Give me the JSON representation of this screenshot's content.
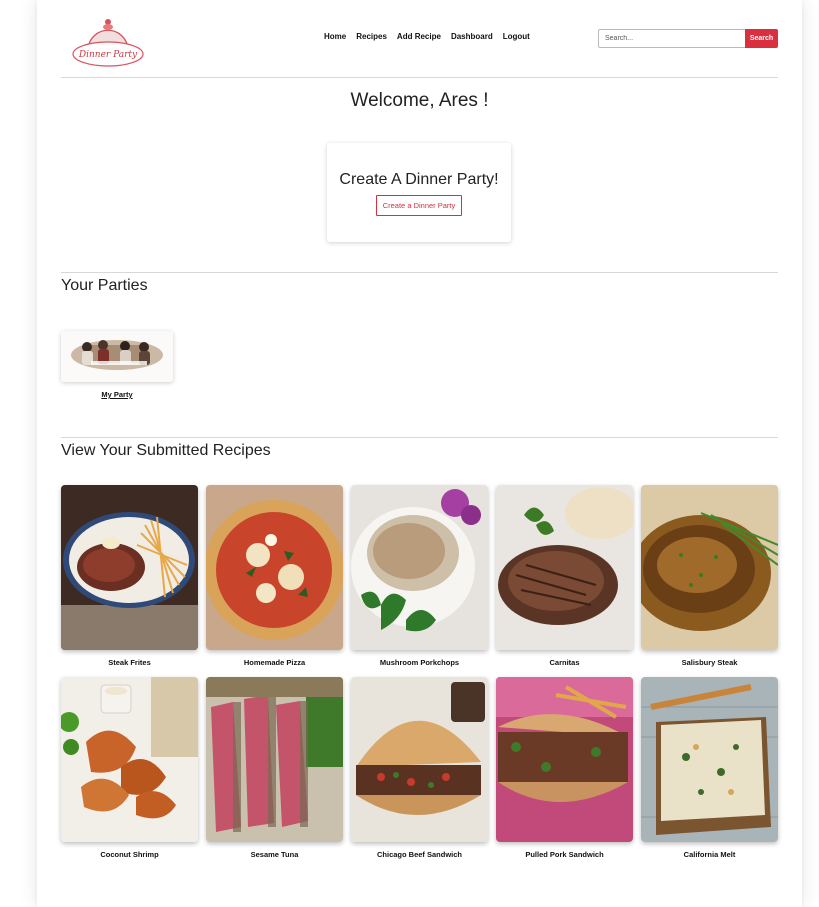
{
  "header": {
    "logo_text": "Dinner Party",
    "nav": [
      "Home",
      "Recipes",
      "Add Recipe",
      "Dashboard",
      "Logout"
    ],
    "search": {
      "placeholder": "Search...",
      "button_label": "Search"
    },
    "accent_color": "#d92f3f"
  },
  "welcome": "Welcome, Ares !",
  "create": {
    "title": "Create A Dinner Party!",
    "button_label": "Create a Dinner Party"
  },
  "parties": {
    "title": "Your Parties",
    "items": [
      {
        "label": "My Party"
      }
    ]
  },
  "recipes": {
    "title": "View Your Submitted Recipes",
    "items": [
      {
        "name": "Steak Frites"
      },
      {
        "name": "Homemade Pizza"
      },
      {
        "name": "Mushroom Porkchops"
      },
      {
        "name": "Carnitas"
      },
      {
        "name": "Salisbury Steak"
      },
      {
        "name": "Coconut Shrimp"
      },
      {
        "name": "Sesame Tuna"
      },
      {
        "name": "Chicago Beef Sandwich"
      },
      {
        "name": "Pulled Pork Sandwich"
      },
      {
        "name": "California Melt"
      }
    ]
  }
}
